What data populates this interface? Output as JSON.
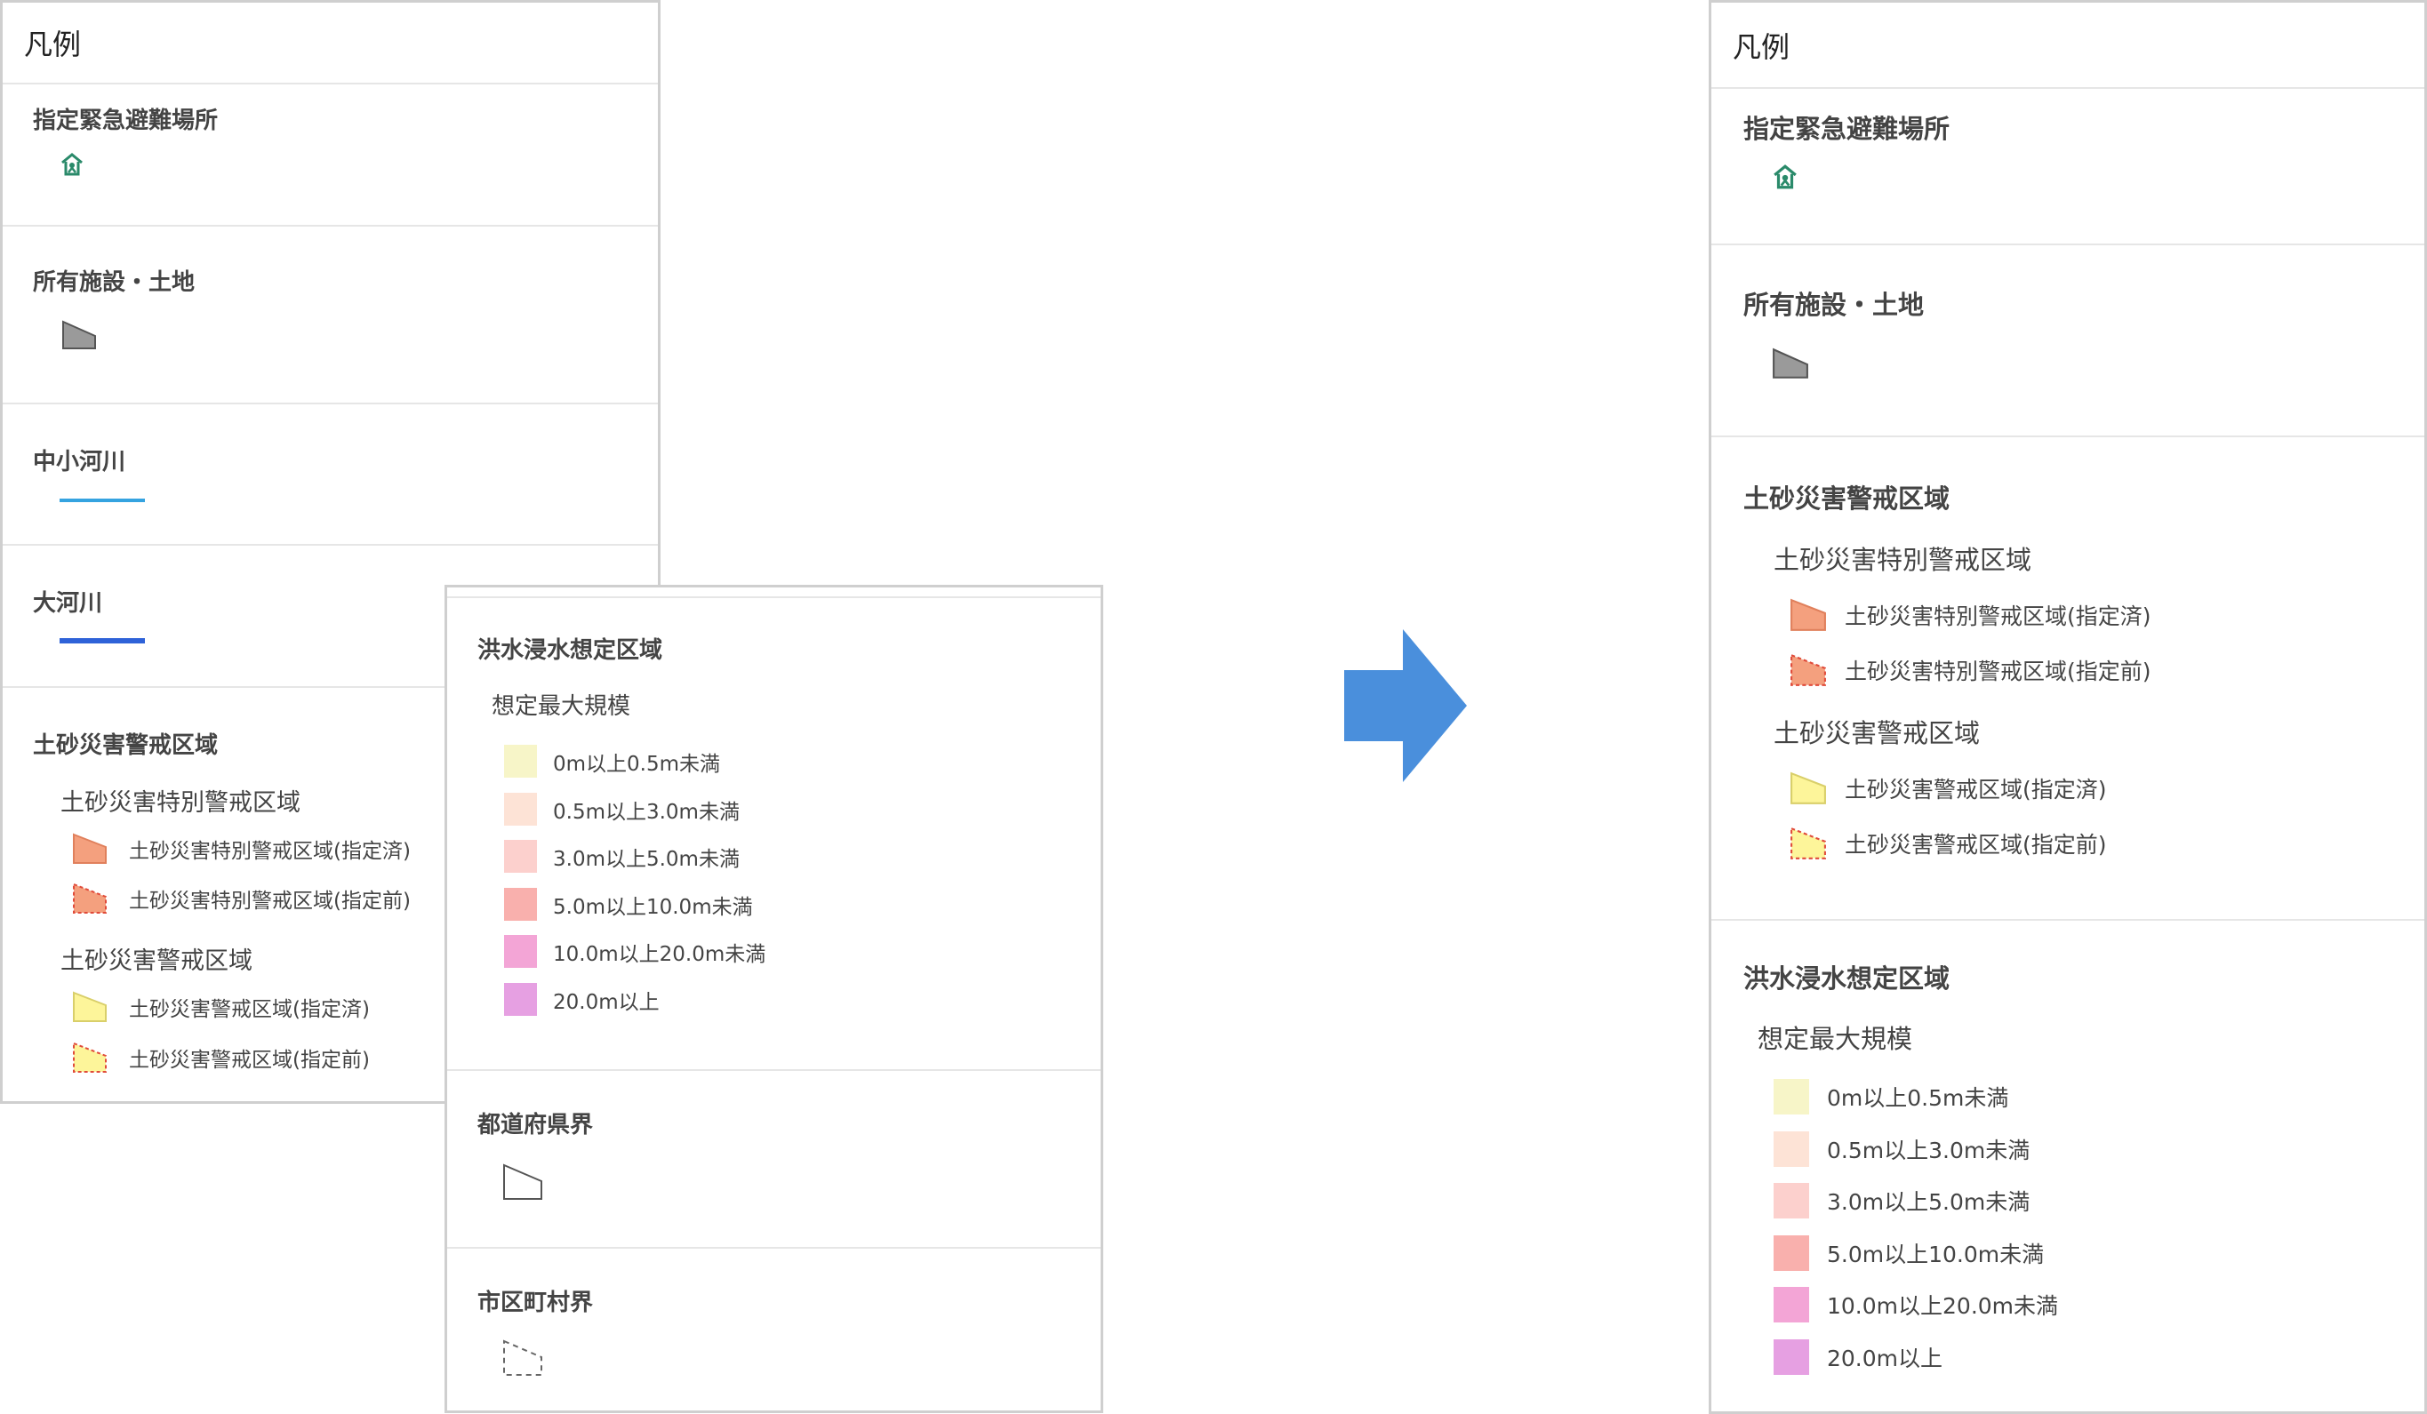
{
  "before": {
    "title": "凡例",
    "shelter": {
      "title": "指定緊急避難場所",
      "icon": "evacuation-shelter-icon"
    },
    "facility": {
      "title": "所有施設・土地",
      "icon": "gray-polygon-icon"
    },
    "small_river": {
      "title": "中小河川",
      "line_color": "#35a3e0"
    },
    "large_river": {
      "title": "大河川",
      "line_color": "#2e62d8"
    },
    "landslide": {
      "title": "土砂災害警戒区域",
      "special_title": "土砂災害特別警戒区域",
      "special_items": [
        "土砂災害特別警戒区域(指定済)",
        "土砂災害特別警戒区域(指定前)"
      ],
      "warning_title": "土砂災害警戒区域",
      "warning_items": [
        "土砂災害警戒区域(指定済)",
        "土砂災害警戒区域(指定前)"
      ]
    }
  },
  "overlay": {
    "flood": {
      "title": "洪水浸水想定区域",
      "sub_title": "想定最大規模",
      "items": [
        {
          "label": "0m以上0.5m未満",
          "color": "#f7f5c8"
        },
        {
          "label": "0.5m以上3.0m未満",
          "color": "#fde3d6"
        },
        {
          "label": "3.0m以上5.0m未満",
          "color": "#fcd0cd"
        },
        {
          "label": "5.0m以上10.0m未満",
          "color": "#f9b0ad"
        },
        {
          "label": "10.0m以上20.0m未満",
          "color": "#f3a5d6"
        },
        {
          "label": "20.0m以上",
          "color": "#e6a0e2"
        }
      ]
    },
    "prefecture": {
      "title": "都道府県界",
      "icon": "outline-polygon-icon"
    },
    "municipality": {
      "title": "市区町村界",
      "icon": "dashed-polygon-icon"
    }
  },
  "after": {
    "title": "凡例",
    "shelter": {
      "title": "指定緊急避難場所",
      "icon": "evacuation-shelter-icon"
    },
    "facility": {
      "title": "所有施設・土地",
      "icon": "gray-polygon-icon"
    },
    "landslide": {
      "title": "土砂災害警戒区域",
      "special_title": "土砂災害特別警戒区域",
      "special_items": [
        "土砂災害特別警戒区域(指定済)",
        "土砂災害特別警戒区域(指定前)"
      ],
      "warning_title": "土砂災害警戒区域",
      "warning_items": [
        "土砂災害警戒区域(指定済)",
        "土砂災害警戒区域(指定前)"
      ]
    },
    "flood": {
      "title": "洪水浸水想定区域",
      "sub_title": "想定最大規模",
      "items": [
        {
          "label": "0m以上0.5m未満",
          "color": "#f7f5c8"
        },
        {
          "label": "0.5m以上3.0m未満",
          "color": "#fde3d6"
        },
        {
          "label": "3.0m以上5.0m未満",
          "color": "#fcd0cd"
        },
        {
          "label": "5.0m以上10.0m未満",
          "color": "#f9b0ad"
        },
        {
          "label": "10.0m以上20.0m未満",
          "color": "#f3a5d6"
        },
        {
          "label": "20.0m以上",
          "color": "#e6a0e2"
        }
      ]
    }
  },
  "arrow": {
    "icon": "right-arrow-icon",
    "color": "#4a8fdc"
  },
  "colors": {
    "special_fill": "#f4a07e",
    "special_stroke": "#e0805c",
    "special_dashed_stroke": "#e04b3a",
    "warning_fill": "#fdf59a",
    "warning_stroke": "#d9cf6a",
    "warning_dashed_stroke": "#e04b3a",
    "facility_fill": "#9a9a9a",
    "shelter_icon": "#2a8a6a"
  }
}
